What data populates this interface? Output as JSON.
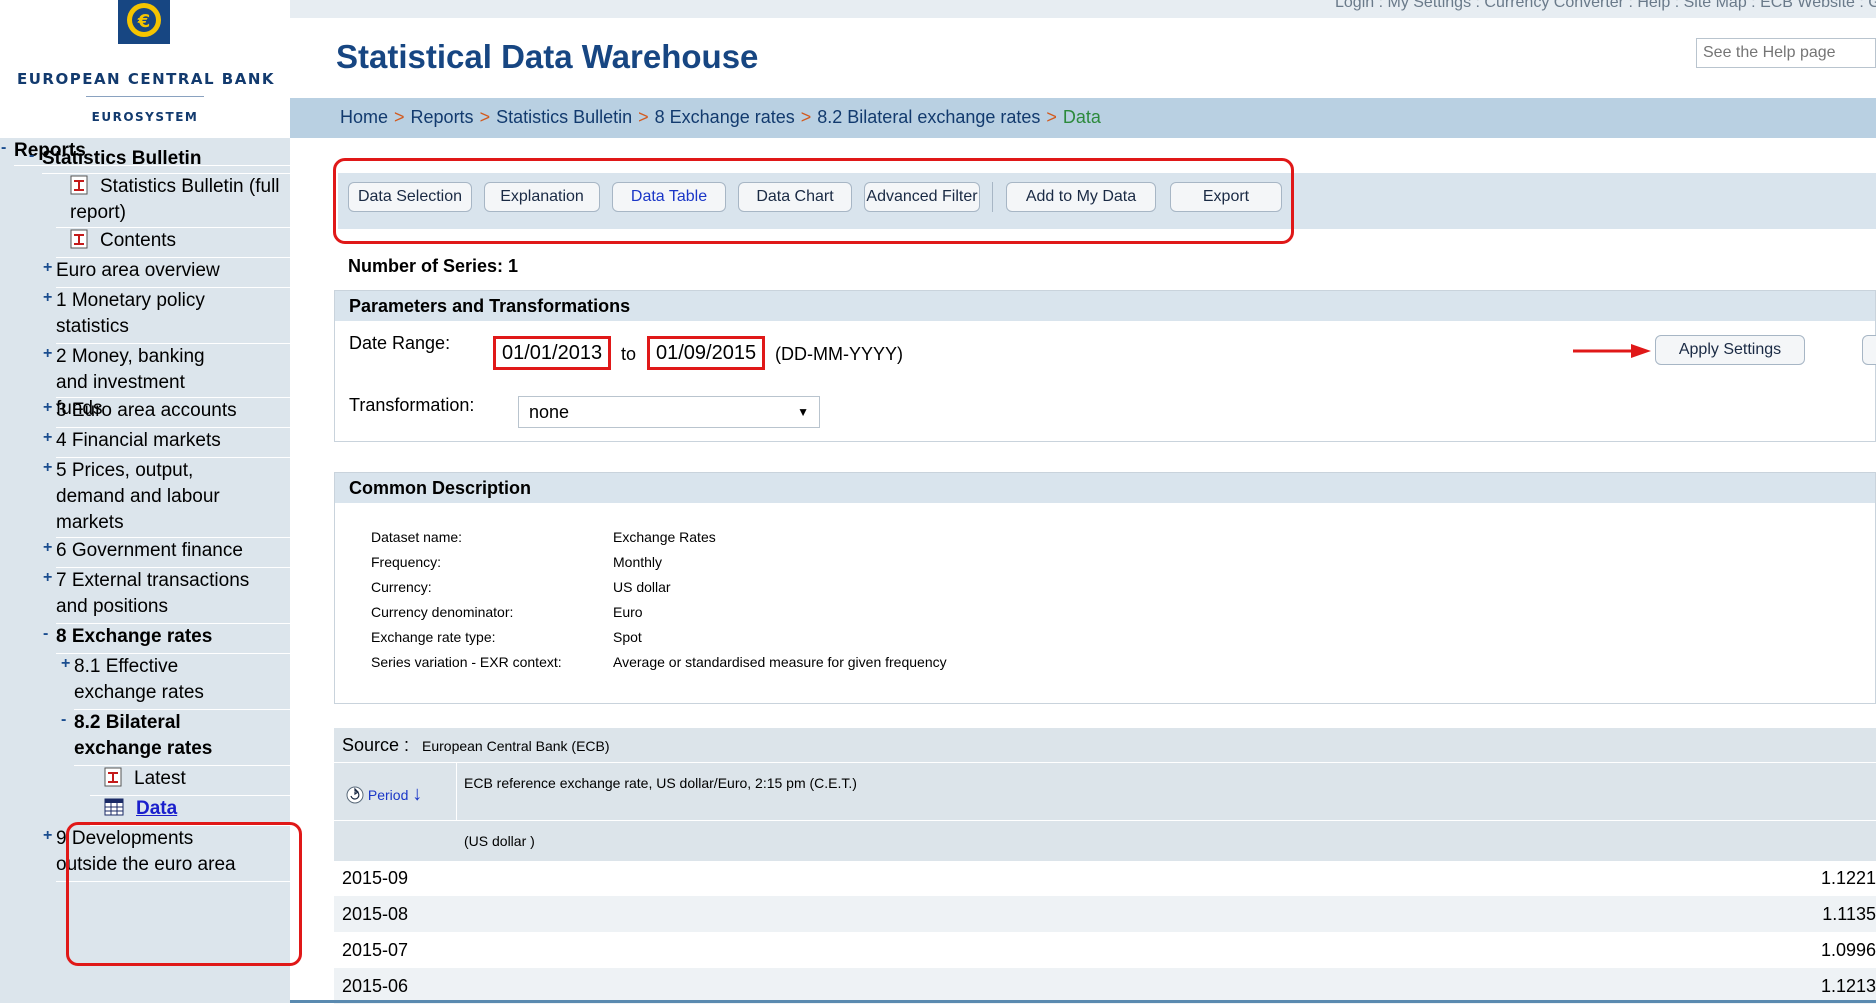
{
  "brand": {
    "title": "EUROPEAN CENTRAL BANK",
    "subtitle": "EUROSYSTEM",
    "accent": "#174682"
  },
  "top_links": "Login : My Settings : Currency Converter : Help : Site Map : ECB Website : Glossary :",
  "header": {
    "title": "Statistical Data Warehouse",
    "search_placeholder": "See the Help page"
  },
  "breadcrumb": {
    "items": [
      "Home",
      "Reports",
      "Statistics Bulletin",
      "8 Exchange rates",
      "8.2 Bilateral exchange rates"
    ],
    "current": "Data",
    "separator": ">"
  },
  "sidebar": {
    "reports": {
      "sign": "-",
      "label": "Reports"
    },
    "bulletin": {
      "sign": "-",
      "label": "Statistics Bulletin"
    },
    "items": [
      {
        "label": "Statistics Bulletin (full report)",
        "icon": "pdf-icon"
      },
      {
        "label": "Contents",
        "icon": "pdf-icon"
      },
      {
        "sign": "+",
        "label": "Euro area overview"
      },
      {
        "sign": "+",
        "label": "1 Monetary policy statistics"
      },
      {
        "sign": "+",
        "label": "2 Money, banking and investment funds"
      },
      {
        "sign": "+",
        "label": "3 Euro area accounts"
      },
      {
        "sign": "+",
        "label": "4 Financial markets"
      },
      {
        "sign": "+",
        "label": "5 Prices, output, demand and labour markets"
      },
      {
        "sign": "+",
        "label": "6 Government finance"
      },
      {
        "sign": "+",
        "label": "7 External transactions and positions"
      },
      {
        "sign": "-",
        "label": "8 Exchange rates"
      },
      {
        "sign": "+",
        "label": "8.1 Effective exchange rates"
      },
      {
        "sign": "-",
        "label": "8.2 Bilateral exchange rates"
      },
      {
        "label": "Latest",
        "icon": "pdf-icon"
      },
      {
        "label": "Data",
        "icon": "table-icon"
      },
      {
        "sign": "+",
        "label": "9 Developments outside the euro area"
      }
    ]
  },
  "toolbar": {
    "buttons": [
      "Data Selection",
      "Explanation",
      "Data Table",
      "Data Chart",
      "Advanced Filter",
      "Add to My Data",
      "Export"
    ],
    "active": "Data Table"
  },
  "series_count": "Number of Series: 1",
  "parameters": {
    "heading": "Parameters and Transformations",
    "date_range_label": "Date Range:",
    "date_from": "01/01/2013",
    "to_label": "to",
    "date_to": "01/09/2015",
    "date_format": "(DD-MM-YYYY)",
    "transformation_label": "Transformation:",
    "transformation_value": "none",
    "apply_label": "Apply Settings"
  },
  "description": {
    "heading": "Common Description",
    "rows": [
      {
        "key": "Dataset name:",
        "value": "Exchange Rates"
      },
      {
        "key": "Frequency:",
        "value": "Monthly"
      },
      {
        "key": "Currency:",
        "value": "US dollar"
      },
      {
        "key": "Currency denominator:",
        "value": "Euro"
      },
      {
        "key": "Exchange rate type:",
        "value": "Spot"
      },
      {
        "key": "Series variation - EXR context:",
        "value": "Average or standardised measure for given frequency"
      }
    ]
  },
  "table": {
    "source_label": "Source :",
    "source_value": "European Central Bank (ECB)",
    "period_label": "Period",
    "series_title": "ECB reference exchange rate, US dollar/Euro, 2:15 pm (C.E.T.)",
    "unit": "(US dollar )",
    "rows": [
      {
        "period": "2015-09",
        "value": "1.1221"
      },
      {
        "period": "2015-08",
        "value": "1.1135"
      },
      {
        "period": "2015-07",
        "value": "1.0996"
      },
      {
        "period": "2015-06",
        "value": "1.1213"
      }
    ]
  },
  "colors": {
    "annotation_red": "#e01818",
    "breadcrumb_bg": "#b9d0e2",
    "sidebar_bg": "#dce5ec"
  }
}
